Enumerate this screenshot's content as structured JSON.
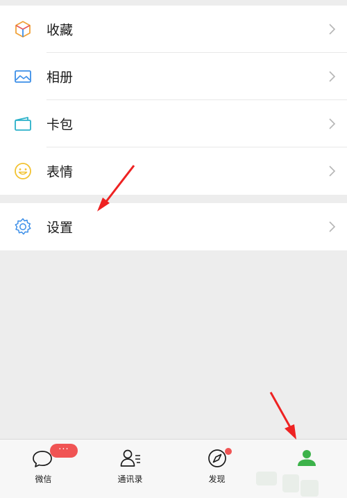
{
  "menu_group_1": [
    {
      "label": "收藏",
      "icon": "favorites-cube-icon"
    },
    {
      "label": "相册",
      "icon": "album-picture-icon"
    },
    {
      "label": "卡包",
      "icon": "card-wallet-icon"
    },
    {
      "label": "表情",
      "icon": "sticker-smiley-icon"
    }
  ],
  "menu_group_2": [
    {
      "label": "设置",
      "icon": "settings-gear-icon"
    }
  ],
  "tabbar": {
    "tabs": [
      {
        "label": "微信",
        "icon": "chat-bubble-icon"
      },
      {
        "label": "通讯录",
        "icon": "contacts-icon"
      },
      {
        "label": "发现",
        "icon": "discover-compass-icon"
      },
      {
        "label": "",
        "icon": "me-person-icon"
      }
    ],
    "chat_badge": "···"
  },
  "colors": {
    "accent_green": "#3cb24a",
    "badge_red": "#f05454",
    "annotation_arrow": "#ee2222"
  }
}
